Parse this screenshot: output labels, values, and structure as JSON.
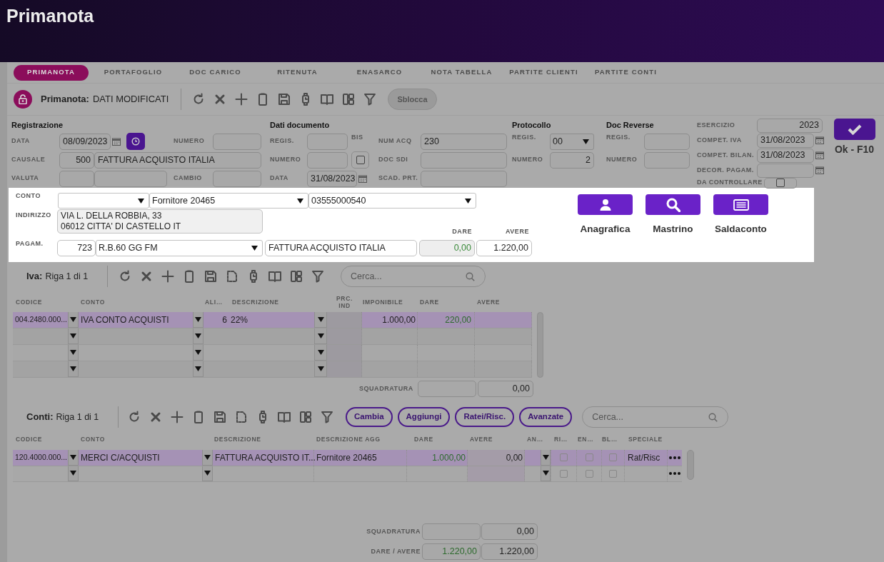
{
  "header": {
    "title": "Primanota"
  },
  "tabs": [
    {
      "label": "PRIMANOTA",
      "selected": true
    },
    {
      "label": "PORTAFOGLIO",
      "selected": false
    },
    {
      "label": "DOC CARICO",
      "selected": false
    },
    {
      "label": "RITENUTA",
      "selected": false
    },
    {
      "label": "ENASARCO",
      "selected": false
    },
    {
      "label": "NOTA TABELLA",
      "selected": false
    },
    {
      "label": "PARTITE CLIENTI",
      "selected": false
    },
    {
      "label": "PARTITE CONTI",
      "selected": false
    }
  ],
  "toolbar": {
    "label": "Primanota:",
    "status": "DATI MODIFICATI",
    "unlock_button": "Sblocca"
  },
  "registrazione": {
    "title": "Registrazione",
    "data": {
      "label": "DATA",
      "value": "08/09/2023"
    },
    "numero": {
      "label": "NUMERO"
    },
    "causale": {
      "label": "CAUSALE",
      "code": "500",
      "value": "FATTURA ACQUISTO ITALIA"
    },
    "valuta": {
      "label": "VALUTA"
    },
    "cambio": {
      "label": "CAMBIO"
    }
  },
  "dati_documento": {
    "title": "Dati documento",
    "regis": {
      "label": "REGIS."
    },
    "bis": {
      "label": "BIS",
      "checked": false
    },
    "numero": {
      "label": "NUMERO"
    },
    "data": {
      "label": "DATA",
      "value": "31/08/2023"
    },
    "num_acq": {
      "label": "NUM ACQ",
      "value": "230"
    },
    "doc_sdi": {
      "label": "DOC SDI"
    },
    "scad_prt": {
      "label": "SCAD. PRT."
    }
  },
  "protocollo": {
    "title": "Protocollo",
    "regis": {
      "label": "REGIS.",
      "value": "00"
    },
    "numero": {
      "label": "NUMERO",
      "value": "2"
    }
  },
  "doc_reverse": {
    "title": "Doc Reverse",
    "regis": {
      "label": "REGIS."
    },
    "numero": {
      "label": "NUMERO"
    }
  },
  "esercizio": {
    "label": "ESERCIZIO",
    "value": "2023"
  },
  "compet_iva": {
    "label": "COMPET. IVA",
    "value": "31/08/2023"
  },
  "compet_bilan": {
    "label": "COMPET. BILAN.",
    "value": "31/08/2023"
  },
  "decor_pagam": {
    "label": "DECOR. PAGAM."
  },
  "da_controllare": {
    "label": "DA CONTROLLARE",
    "checked": false
  },
  "ok_button": {
    "label": "Ok - F10"
  },
  "conto_panel": {
    "conto": {
      "label": "CONTO",
      "select_2": "Fornitore 20465",
      "select_3": "03555000540"
    },
    "indirizzo": {
      "label": "INDIRIZZO",
      "lines": [
        "VIA L. DELLA ROBBIA, 33",
        "06012 CITTA' DI CASTELLO IT"
      ]
    },
    "pagam": {
      "label": "PAGAM.",
      "code": "723",
      "value": "R.B.60 GG FM",
      "description": "FATTURA ACQUISTO ITALIA"
    },
    "dare": {
      "label": "DARE",
      "value": "0,00"
    },
    "avere": {
      "label": "AVERE",
      "value": "1.220,00"
    },
    "buttons": [
      {
        "label": "Anagrafica",
        "kind": "person"
      },
      {
        "label": "Mastrino",
        "kind": "search"
      },
      {
        "label": "Saldaconto",
        "kind": "list"
      }
    ]
  },
  "iva": {
    "label": "Iva:",
    "position": "Riga 1 di 1",
    "search_placeholder": "Cerca...",
    "columns": [
      "CODICE",
      "CONTO",
      "ALI…",
      "DESCRIZIONE",
      "PRC. IND",
      "IMPONIBILE",
      "DARE",
      "AVERE"
    ],
    "rows": [
      {
        "codice": "004.2480.000...",
        "conto": "IVA CONTO ACQUISTI",
        "aliquota": "6",
        "descrizione": "22%",
        "imponibile": "1.000,00",
        "dare": "220,00",
        "selected": true
      },
      {
        "selected": false
      },
      {
        "selected": false
      },
      {
        "selected": false
      }
    ],
    "squadratura": {
      "label": "SQUADRATURA",
      "value": "0,00"
    }
  },
  "conti": {
    "label": "Conti:",
    "position": "Riga 1 di 1",
    "buttons": [
      "Cambia",
      "Aggiungi",
      "Ratei/Risc.",
      "Avanzate"
    ],
    "search_placeholder": "Cerca...",
    "columns": [
      "CODICE",
      "CONTO",
      "DESCRIZIONE",
      "DESCRIZIONE AGG",
      "DARE",
      "AVERE",
      "AN…",
      "RI…",
      "EN…",
      "BL…",
      "SPECIALE"
    ],
    "rows": [
      {
        "codice": "120.4000.000...",
        "conto": "MERCI C/ACQUISTI",
        "descrizione": "FATTURA ACQUISTO IT...",
        "descrizione_agg": "Fornitore 20465",
        "dare": "1.000,00",
        "avere": "0,00",
        "ri": false,
        "en": false,
        "bl": false,
        "speciale": "Rat/Risc",
        "selected": true
      },
      {
        "ri": false,
        "en": false,
        "bl": false,
        "selected": false
      }
    ]
  },
  "totals": {
    "squadratura": {
      "label": "SQUADRATURA",
      "value": "0,00"
    },
    "dare_avere": {
      "label": "DARE / AVERE",
      "dare": "1.220,00",
      "avere": "1.220,00"
    }
  }
}
